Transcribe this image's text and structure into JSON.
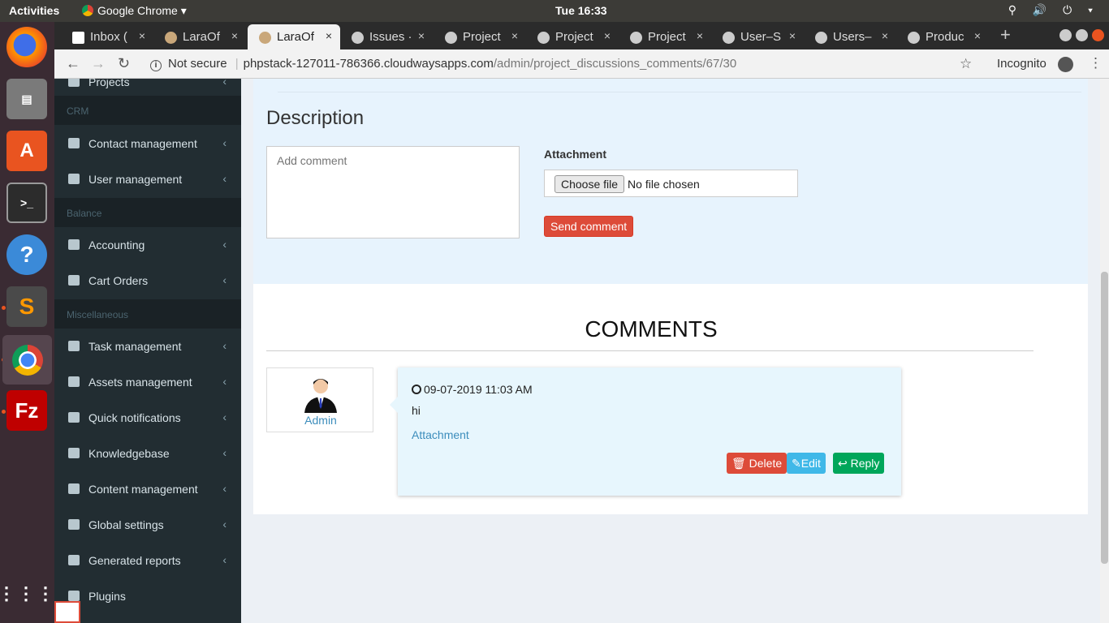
{
  "topbar": {
    "activities": "Activities",
    "app": "Google Chrome ▾",
    "clock": "Tue 16:33",
    "tray": "⚲ 🔊 ⏻ ▾"
  },
  "tabs": [
    {
      "label": "Inbox (",
      "close": "×"
    },
    {
      "label": "LaraOf",
      "close": "×"
    },
    {
      "label": "LaraOf",
      "close": "×"
    },
    {
      "label": "Issues ·",
      "close": "×"
    },
    {
      "label": "Project",
      "close": "×"
    },
    {
      "label": "Project",
      "close": "×"
    },
    {
      "label": "Project",
      "close": "×"
    },
    {
      "label": "User–S",
      "close": "×"
    },
    {
      "label": "Users–",
      "close": "×"
    },
    {
      "label": "Produc",
      "close": "×"
    }
  ],
  "newtab": "+",
  "address": {
    "back": "←",
    "forward": "→",
    "reload": "↻",
    "info": "i",
    "security": "Not secure",
    "host": "phpstack-127011-786366.cloudwaysapps.com",
    "path": "/admin/project_discussions_comments/67/30",
    "star": "☆",
    "incognito": "Incognito",
    "menu": "⋮"
  },
  "sidebar": {
    "partial_top": "Projects",
    "headers": {
      "crm": "CRM",
      "balance": "Balance",
      "misc": "Miscellaneous"
    },
    "items": [
      {
        "label": "Contact management"
      },
      {
        "label": "User management"
      },
      {
        "label": "Accounting"
      },
      {
        "label": "Cart Orders"
      },
      {
        "label": "Task management"
      },
      {
        "label": "Assets management"
      },
      {
        "label": "Quick notifications"
      },
      {
        "label": "Knowledgebase"
      },
      {
        "label": "Content management"
      },
      {
        "label": "Global settings"
      },
      {
        "label": "Generated reports"
      },
      {
        "label": "Plugins"
      }
    ],
    "chevron": "‹"
  },
  "form": {
    "title": "Description",
    "comment_placeholder": "Add comment",
    "attachment_label": "Attachment",
    "choose_file": "Choose file",
    "no_file": "No file chosen",
    "send": "Send comment"
  },
  "comments": {
    "title": "COMMENTS",
    "items": [
      {
        "author": "Admin",
        "datetime": "09-07-2019 11:03 AM",
        "text": "hi",
        "attachment": "Attachment",
        "delete": "🗑 Delete",
        "edit": "✎Edit",
        "reply": "↩ Reply"
      }
    ]
  },
  "colors": {
    "sidebar_bg": "#222d32",
    "panel_bg": "#e7f3fd",
    "danger": "#dd4b39",
    "info": "#3fb8e8",
    "success": "#00a65a",
    "link": "#3c8dbc"
  },
  "icons": [
    "firefox-icon",
    "files-icon",
    "software-center-icon",
    "terminal-icon",
    "help-icon",
    "sublime-icon",
    "chrome-icon",
    "filezilla-icon",
    "app-grid-icon"
  ]
}
